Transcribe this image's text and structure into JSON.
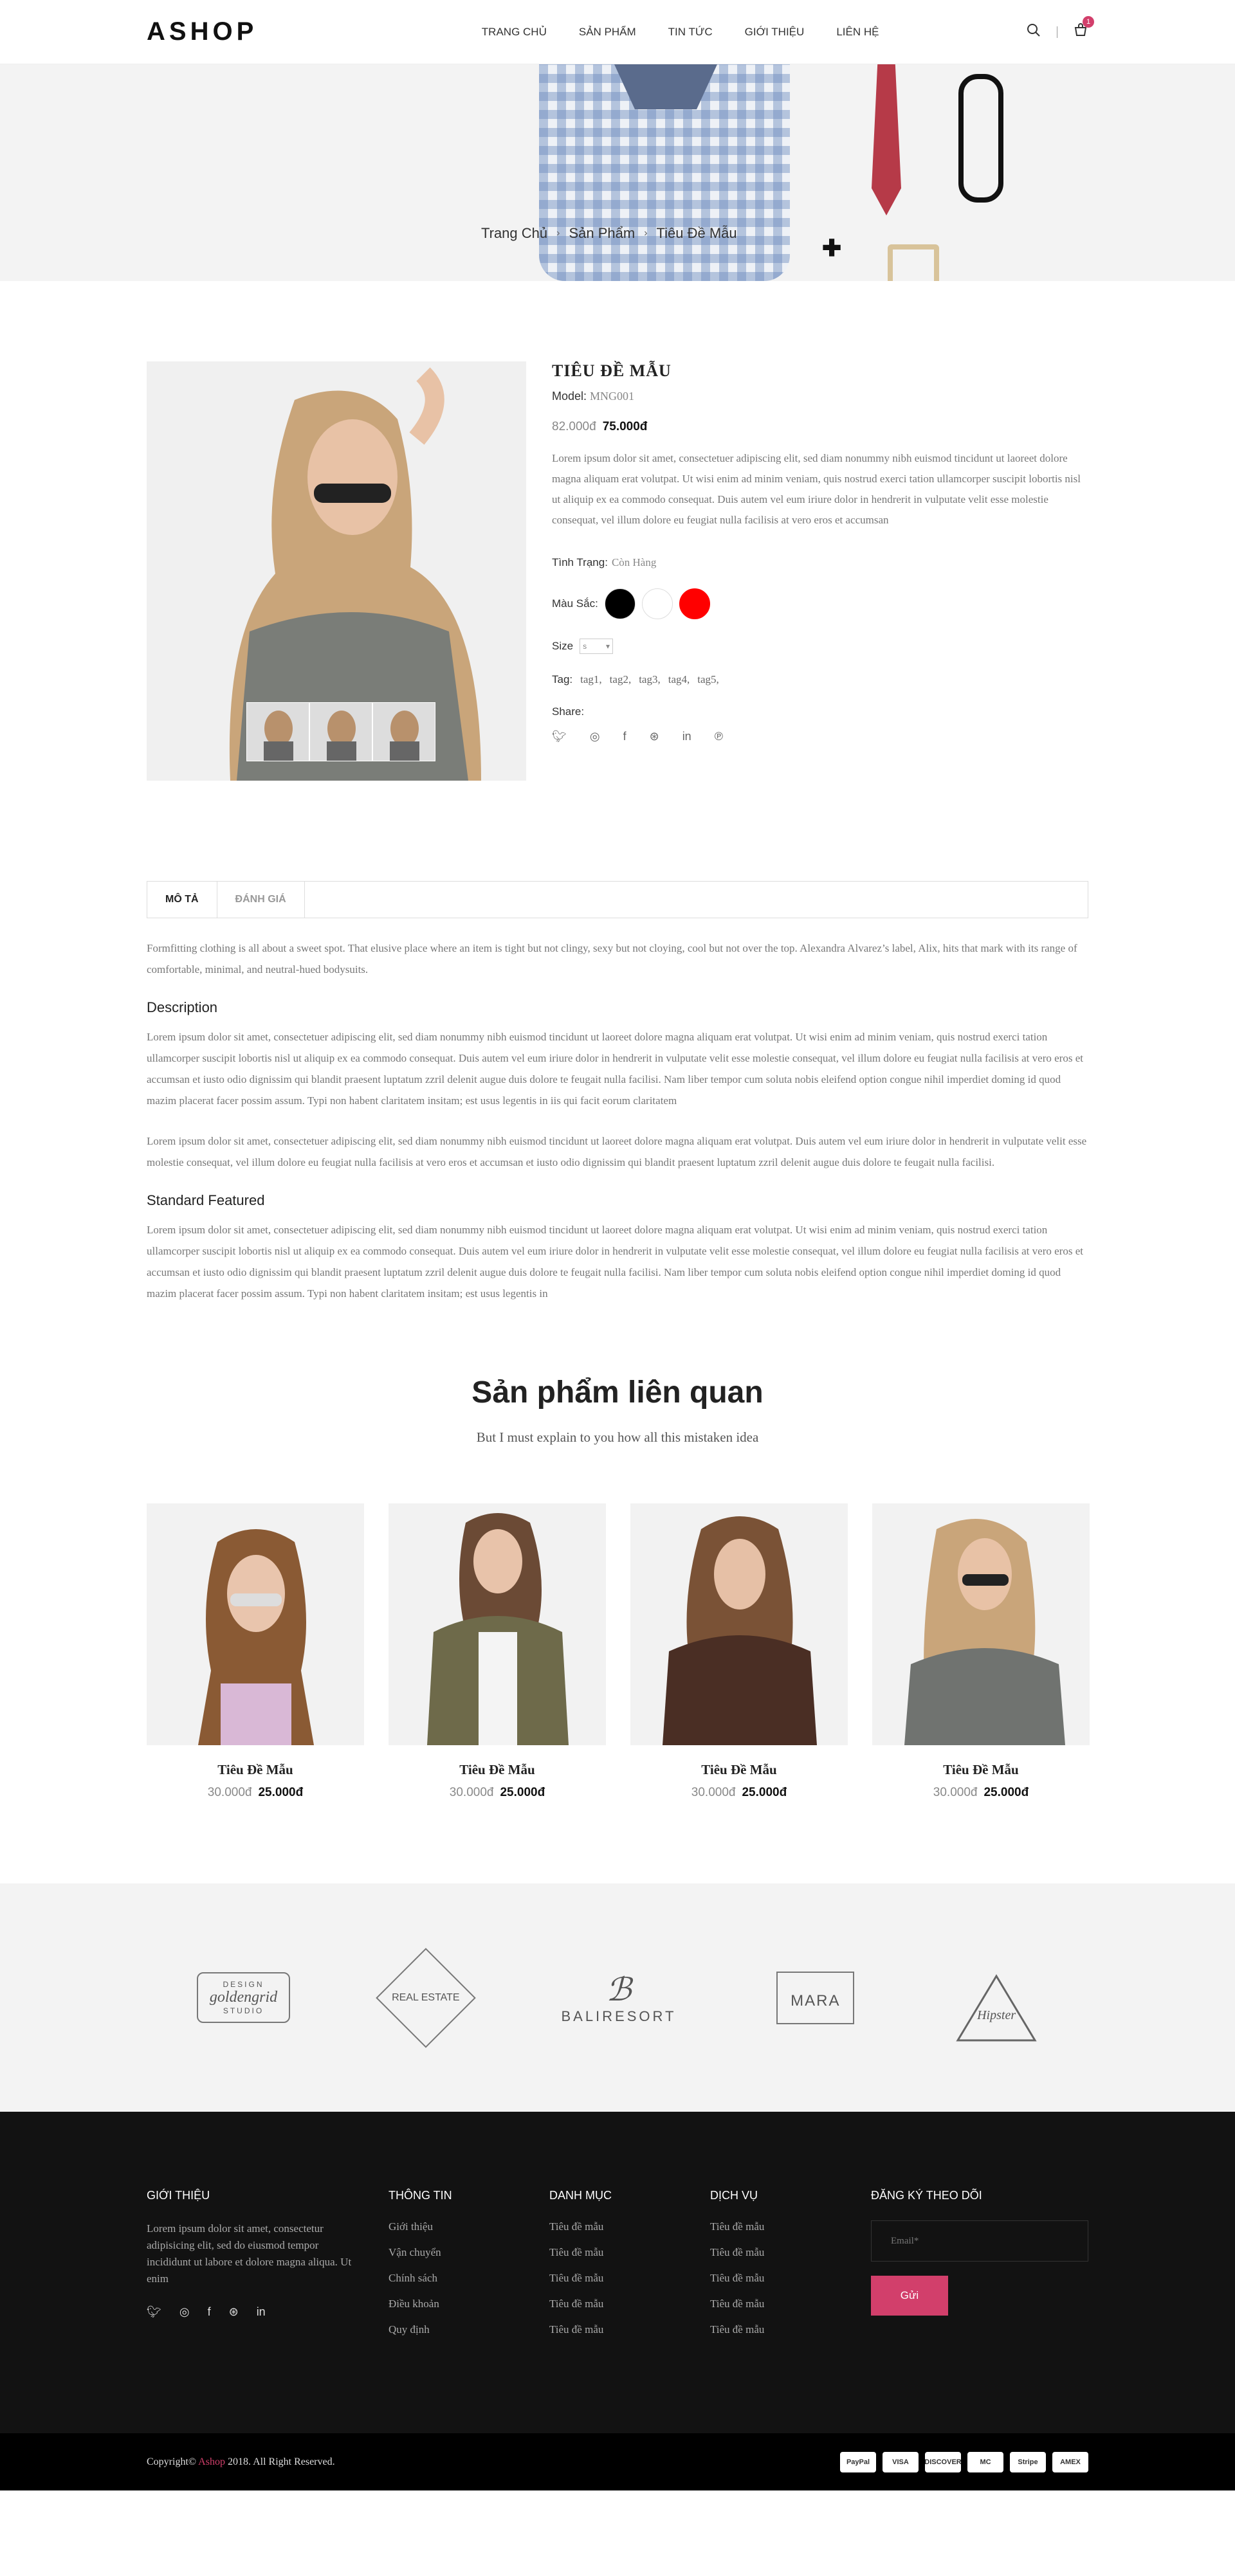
{
  "header": {
    "logo": "ASHOP",
    "nav": [
      "TRANG CHỦ",
      "SẢN PHẨM",
      "TIN TỨC",
      "GIỚI THIỆU",
      "LIÊN HỆ"
    ],
    "cart_count": "1"
  },
  "breadcrumb": [
    "Trang Chủ",
    "Sản Phẩm",
    "Tiêu Đề Mẫu"
  ],
  "product": {
    "title": "TIÊU ĐỀ MẪU",
    "model_label": "Model:",
    "model_value": "MNG001",
    "old_price": "82.000đ",
    "new_price": "75.000đ",
    "description": "Lorem ipsum dolor sit amet, consectetuer adipiscing elit, sed diam nonummy nibh euismod tincidunt ut laoreet dolore magna aliquam erat volutpat. Ut wisi enim ad minim veniam, quis nostrud exerci tation ullamcorper suscipit lobortis nisl ut aliquip ex ea commodo consequat. Duis autem vel eum iriure dolor in hendrerit in vulputate velit esse molestie consequat, vel illum dolore eu feugiat nulla facilisis at vero eros et accumsan",
    "status_label": "Tình Trạng:",
    "status_value": "Còn Hàng",
    "color_label": "Màu Sắc:",
    "colors": [
      "#000000",
      "#ffffff",
      "#ff0000"
    ],
    "size_label": "Size",
    "size_value": "s",
    "tags_label": "Tag:",
    "tags": [
      "tag1,",
      "tag2,",
      "tag3,",
      "tag4,",
      "tag5,"
    ],
    "share_label": "Share:"
  },
  "tabs": {
    "items": [
      "MÔ TẢ",
      "ĐÁNH GIÁ"
    ],
    "intro": "Formfitting clothing is all about a sweet spot. That elusive place where an item is tight but not clingy, sexy but not cloying, cool but not over the top. Alexandra Alvarez’s label, Alix, hits that mark with its range of comfortable, minimal, and neutral-hued bodysuits.",
    "h1": "Description",
    "p1": "Lorem ipsum dolor sit amet, consectetuer adipiscing elit, sed diam nonummy nibh euismod tincidunt ut laoreet dolore magna aliquam erat volutpat. Ut wisi enim ad minim veniam, quis nostrud exerci tation ullamcorper suscipit lobortis nisl ut aliquip ex ea commodo consequat. Duis autem vel eum iriure dolor in hendrerit in vulputate velit esse molestie consequat, vel illum dolore eu feugiat nulla facilisis at vero eros et accumsan et iusto odio dignissim qui blandit praesent luptatum zzril delenit augue duis dolore te feugait nulla facilisi. Nam liber tempor cum soluta nobis eleifend option congue nihil imperdiet doming id quod mazim placerat facer possim assum. Typi non habent claritatem insitam; est usus legentis in iis qui facit eorum claritatem",
    "p2": "Lorem ipsum dolor sit amet, consectetuer adipiscing elit, sed diam nonummy nibh euismod tincidunt ut laoreet dolore magna aliquam erat volutpat. Duis autem vel eum iriure dolor in hendrerit in vulputate velit esse molestie consequat, vel illum dolore eu feugiat nulla facilisis at vero eros et accumsan et iusto odio dignissim qui blandit praesent luptatum zzril delenit augue duis dolore te feugait nulla facilisi.",
    "h2": "Standard Featured",
    "p3": "Lorem ipsum dolor sit amet, consectetuer adipiscing elit, sed diam nonummy nibh euismod tincidunt ut laoreet dolore magna aliquam erat volutpat. Ut wisi enim ad minim veniam, quis nostrud exerci tation ullamcorper suscipit lobortis nisl ut aliquip ex ea commodo consequat. Duis autem vel eum iriure dolor in hendrerit in vulputate velit esse molestie consequat, vel illum dolore eu feugiat nulla facilisis at vero eros et accumsan et iusto odio dignissim qui blandit praesent luptatum zzril delenit augue duis dolore te feugait nulla facilisi. Nam liber tempor cum soluta nobis eleifend option congue nihil imperdiet doming id quod mazim placerat facer possim assum. Typi non habent claritatem insitam; est usus legentis in"
  },
  "related": {
    "title": "Sản phẩm liên quan",
    "subtitle": "But I must explain to you how all this mistaken idea",
    "items": [
      {
        "name": "Tiêu Đề Mẫu",
        "old": "30.000đ",
        "new": "25.000đ"
      },
      {
        "name": "Tiêu Đề Mẫu",
        "old": "30.000đ",
        "new": "25.000đ"
      },
      {
        "name": "Tiêu Đề Mẫu",
        "old": "30.000đ",
        "new": "25.000đ"
      },
      {
        "name": "Tiêu Đề Mẫu",
        "old": "30.000đ",
        "new": "25.000đ"
      }
    ]
  },
  "brands": [
    {
      "top": "DESIGN",
      "main": "goldengrid",
      "bottom": "STUDIO"
    },
    {
      "top": "",
      "main": "REAL ESTATE",
      "bottom": ""
    },
    {
      "top": "",
      "main": "BALIRESORT",
      "bottom": ""
    },
    {
      "top": "",
      "main": "MARA",
      "bottom": ""
    },
    {
      "top": "",
      "main": "Hipster",
      "bottom": ""
    }
  ],
  "footer": {
    "about_title": "GIỚI THIỆU",
    "about_text": "Lorem ipsum dolor sit amet, consectetur adipisicing elit, sed do eiusmod tempor incididunt ut labore et dolore magna aliqua. Ut enim",
    "info_title": "THÔNG TIN",
    "info_items": [
      "Giới thiệu",
      "Vận chuyển",
      "Chính sách",
      "Điều khoản",
      "Quy định"
    ],
    "cat_title": "DANH MỤC",
    "cat_items": [
      "Tiêu đề mẫu",
      "Tiêu đề mẫu",
      "Tiêu đề mẫu",
      "Tiêu đề mẫu",
      "Tiêu đề mẫu"
    ],
    "svc_title": "DỊCH VỤ",
    "svc_items": [
      "Tiêu đề mẫu",
      "Tiêu đề mẫu",
      "Tiêu đề mẫu",
      "Tiêu đề mẫu",
      "Tiêu đề mẫu"
    ],
    "sub_title": "ĐĂNG KÝ THEO DÕI",
    "email_placeholder": "Email*",
    "send_label": "Gửi"
  },
  "bottom": {
    "copy_pre": "Copyright©",
    "copy_brand": "Ashop",
    "copy_post": "2018. All Right Reserved.",
    "payments": [
      "PayPal",
      "VISA",
      "DISCOVER",
      "MC",
      "Stripe",
      "AMEX"
    ]
  }
}
